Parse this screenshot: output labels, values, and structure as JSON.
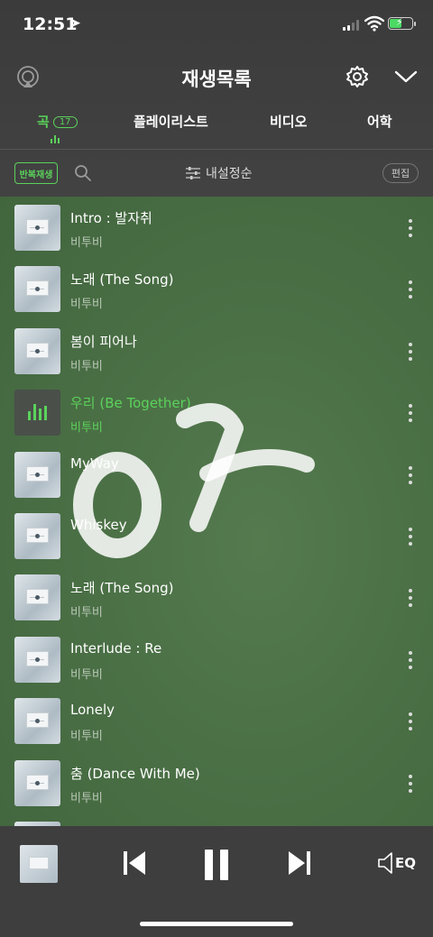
{
  "status_bar": {
    "time": "12:51"
  },
  "header": {
    "title": "재생목록"
  },
  "tabs": [
    {
      "label": "곡",
      "count": "17",
      "active": true
    },
    {
      "label": "플레이리스트"
    },
    {
      "label": "비디오"
    },
    {
      "label": "어학"
    }
  ],
  "toolbar": {
    "repeat_label": "반복재생",
    "sort_label": "내설정순",
    "edit_label": "편집"
  },
  "songs": [
    {
      "title": "Intro : 발자취",
      "artist": "비투비"
    },
    {
      "title": "노래 (The Song)",
      "artist": "비투비"
    },
    {
      "title": "봄이 피어나",
      "artist": "비투비"
    },
    {
      "title": "우리 (Be Together)",
      "artist": "비투비",
      "playing": true
    },
    {
      "title": "MyWay",
      "artist": ""
    },
    {
      "title": "Whiskey",
      "artist": ""
    },
    {
      "title": "노래 (The Song)",
      "artist": "비투비"
    },
    {
      "title": "Interlude : Re",
      "artist": "비투비"
    },
    {
      "title": "Lonely",
      "artist": "비투비"
    },
    {
      "title": "춤 (Dance With Me)",
      "artist": "비투비"
    }
  ],
  "player": {
    "eq_label": "EQ"
  },
  "colors": {
    "accent": "#5bd25b",
    "list_bg": "#4b7046"
  }
}
